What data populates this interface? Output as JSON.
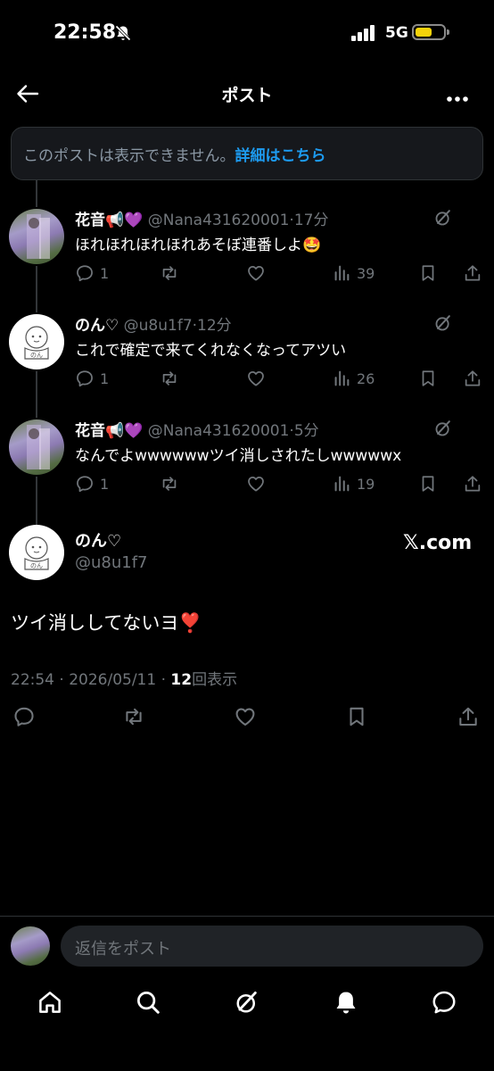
{
  "status_bar": {
    "time": "22:58",
    "network": "5G"
  },
  "header": {
    "title": "ポスト"
  },
  "banner": {
    "text": "このポストは表示できません。",
    "link": "詳細はこちら"
  },
  "replies": [
    {
      "name": "花音",
      "name_emoji": "📢💜",
      "handle": "@Nana431620001",
      "time": "17分",
      "text": "ほれほれほれほれあそぼ連番しよ🤩",
      "replies": "1",
      "views": "39"
    },
    {
      "name": "のん♡",
      "name_emoji": "",
      "handle": "@u8u1f7",
      "time": "12分",
      "text": "これで確定で来てくれなくなってアツい",
      "replies": "1",
      "views": "26"
    },
    {
      "name": "花音",
      "name_emoji": "📢💜",
      "handle": "@Nana431620001",
      "time": "5分",
      "text": "なんでよwwwwwwツイ消しされたしwwwwwx",
      "replies": "1",
      "views": "19"
    }
  ],
  "main_post": {
    "name": "のん♡",
    "handle": "@u8u1f7",
    "source": "𝕏.com",
    "text": "ツイ消ししてないヨ❣️",
    "timestamp": "22:54 · 2026/05/11 · ",
    "view_count": "12",
    "view_label": "回表示"
  },
  "reply_bar": {
    "placeholder": "返信をポスト"
  },
  "bottom_nav": [
    "home-icon",
    "search-icon",
    "grok-icon",
    "notifications-icon",
    "messages-icon"
  ],
  "colors": {
    "accent": "#1d9bf0",
    "background": "#000000",
    "muted": "#71767b",
    "battery": "#f5d30a"
  }
}
